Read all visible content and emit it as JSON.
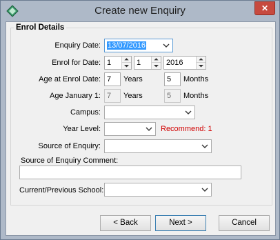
{
  "window": {
    "title": "Create new Enquiry",
    "close_label": "✕"
  },
  "group": {
    "title": "Enrol Details"
  },
  "enquiry_date": {
    "label": "Enquiry Date:",
    "value": "13/07/2016"
  },
  "enrol_for_date": {
    "label": "Enrol for Date:",
    "day": "1",
    "month": "1",
    "year": "2016"
  },
  "age_at_enrol": {
    "label": "Age at Enrol Date:",
    "years": "7",
    "years_label": "Years",
    "months": "5",
    "months_label": "Months"
  },
  "age_january": {
    "label": "Age January 1:",
    "years": "7",
    "years_label": "Years",
    "months": "5",
    "months_label": "Months"
  },
  "campus": {
    "label": "Campus:",
    "value": ""
  },
  "year_level": {
    "label": "Year Level:",
    "value": "",
    "recommend": "Recommend: 1"
  },
  "source_of_enquiry": {
    "label": "Source of Enquiry:",
    "value": ""
  },
  "source_comment": {
    "label": "Source of Enquiry Comment:",
    "value": ""
  },
  "current_school": {
    "label": "Current/Previous School:",
    "value": ""
  },
  "buttons": {
    "back": "< Back",
    "next": "Next >",
    "cancel": "Cancel"
  },
  "colors": {
    "titlebar": "#aeb9c8",
    "close": "#c74a3f",
    "selection": "#3399ff",
    "recommend": "#d10000"
  }
}
